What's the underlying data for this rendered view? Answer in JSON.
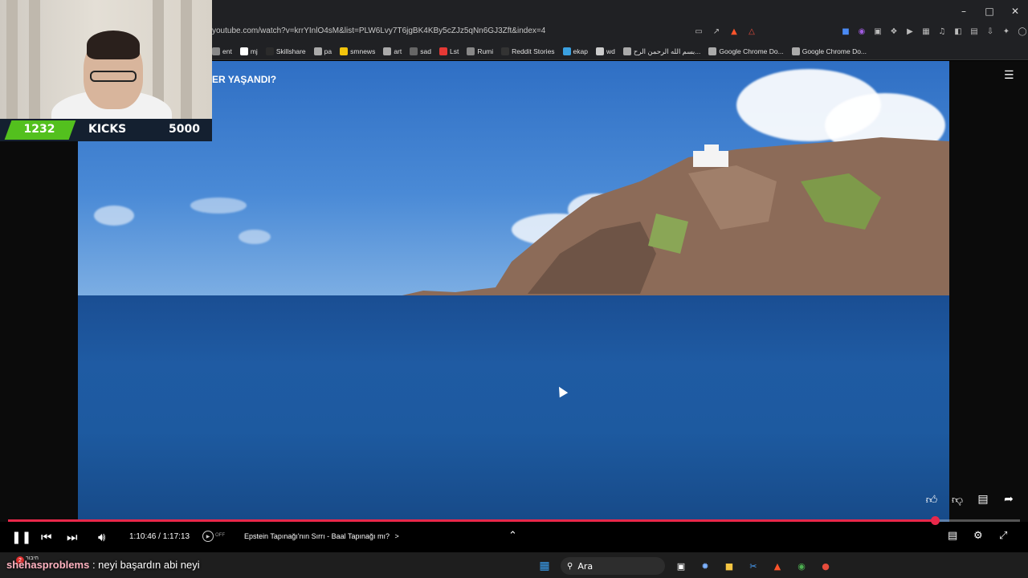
{
  "browser": {
    "url": "youtube.com/watch?v=krrYInlO4sM&list=PLW6Lvy7T6jgBK4KBy5cZJz5qNn6GJ3Zft&index=4",
    "bookmarks": [
      {
        "label": "ent",
        "icon": "page-icon",
        "color": "#888888"
      },
      {
        "label": "mj",
        "icon": "github-icon",
        "color": "#ffffff"
      },
      {
        "label": "Skillshare",
        "icon": "skillshare-icon",
        "color": "#2b2b2b"
      },
      {
        "label": "pa",
        "icon": "folder-icon",
        "color": "#aaaaaa"
      },
      {
        "label": "smnews",
        "icon": "smiley-icon",
        "color": "#f2c40c"
      },
      {
        "label": "art",
        "icon": "folder-icon",
        "color": "#aaaaaa"
      },
      {
        "label": "sad",
        "icon": "slash-icon",
        "color": "#666666"
      },
      {
        "label": "Lst",
        "icon": "s-icon",
        "color": "#e53935"
      },
      {
        "label": "Rumi",
        "icon": "globe-icon",
        "color": "#888888"
      },
      {
        "label": "Reddit Stories",
        "icon": "d-icon",
        "color": "#333333"
      },
      {
        "label": "ekap",
        "icon": "bird-icon",
        "color": "#3aa0e0"
      },
      {
        "label": "wd",
        "icon": "w-icon",
        "color": "#cccccc"
      },
      {
        "label": "بسم الله الرحمن الرح...",
        "icon": "doc-icon",
        "color": "#aaaaaa"
      },
      {
        "label": "Google Chrome Do...",
        "icon": "folder-icon",
        "color": "#aaaaaa"
      },
      {
        "label": "Google Chrome Do...",
        "icon": "folder-icon",
        "color": "#aaaaaa"
      }
    ]
  },
  "video": {
    "title_fragment": "ER YAŞANDI?"
  },
  "overlay": {
    "count_left": "1232",
    "kicks_label": "KICKS",
    "goal": "5000"
  },
  "player": {
    "time": "1:10:46 / 1:17:13",
    "chapter": "Epstein Tapınağı'nın Sırrı - Baal Tapınağı mı?",
    "chapter_arrow": ">",
    "autoplay_label": "OFF",
    "progress_fraction": 0.916,
    "accent": "#e8284a"
  },
  "chat": {
    "badge_count": "2",
    "badge_label": "חיבור",
    "username": "shehasproblems",
    "separator": " : ",
    "message": "neyi başardın abi neyi"
  },
  "taskbar": {
    "search_placeholder": "Ara"
  }
}
